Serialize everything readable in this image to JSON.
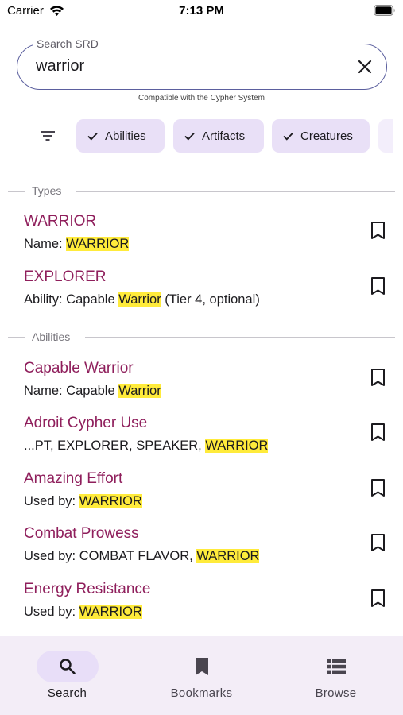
{
  "status_bar": {
    "carrier": "Carrier",
    "time": "7:13 PM"
  },
  "search": {
    "label": "Search SRD",
    "value": "warrior",
    "compat_note": "Compatible with the Cypher System"
  },
  "filters": {
    "chips": [
      {
        "label": "Abilities",
        "selected": true
      },
      {
        "label": "Artifacts",
        "selected": true
      },
      {
        "label": "Creatures",
        "selected": true
      }
    ]
  },
  "sections": [
    {
      "title": "Types",
      "results": [
        {
          "title": "WARRIOR",
          "prefix": "Name: ",
          "highlight": "WARRIOR",
          "suffix": ""
        },
        {
          "title": "EXPLORER",
          "prefix": "Ability: Capable ",
          "highlight": "Warrior",
          "suffix": " (Tier 4, optional)"
        }
      ]
    },
    {
      "title": "Abilities",
      "results": [
        {
          "title": "Capable Warrior",
          "prefix": "Name: Capable ",
          "highlight": "Warrior",
          "suffix": ""
        },
        {
          "title": "Adroit Cypher Use",
          "prefix": "...PT, EXPLORER, SPEAKER, ",
          "highlight": "WARRIOR",
          "suffix": ""
        },
        {
          "title": "Amazing Effort",
          "prefix": "Used by: ",
          "highlight": "WARRIOR",
          "suffix": ""
        },
        {
          "title": "Combat Prowess",
          "prefix": "Used by: COMBAT FLAVOR, ",
          "highlight": "WARRIOR",
          "suffix": ""
        },
        {
          "title": "Energy Resistance",
          "prefix": "Used by: ",
          "highlight": "WARRIOR",
          "suffix": ""
        }
      ]
    }
  ],
  "bottom_nav": [
    {
      "label": "Search",
      "icon": "search-icon",
      "active": true
    },
    {
      "label": "Bookmarks",
      "icon": "bookmark-icon",
      "active": false
    },
    {
      "label": "Browse",
      "icon": "list-icon",
      "active": false
    }
  ],
  "colors": {
    "accent": "#8f1f5c",
    "chip_bg": "#e9e0f7",
    "highlight": "#ffeb3b",
    "nav_bg": "#f3edf7"
  }
}
